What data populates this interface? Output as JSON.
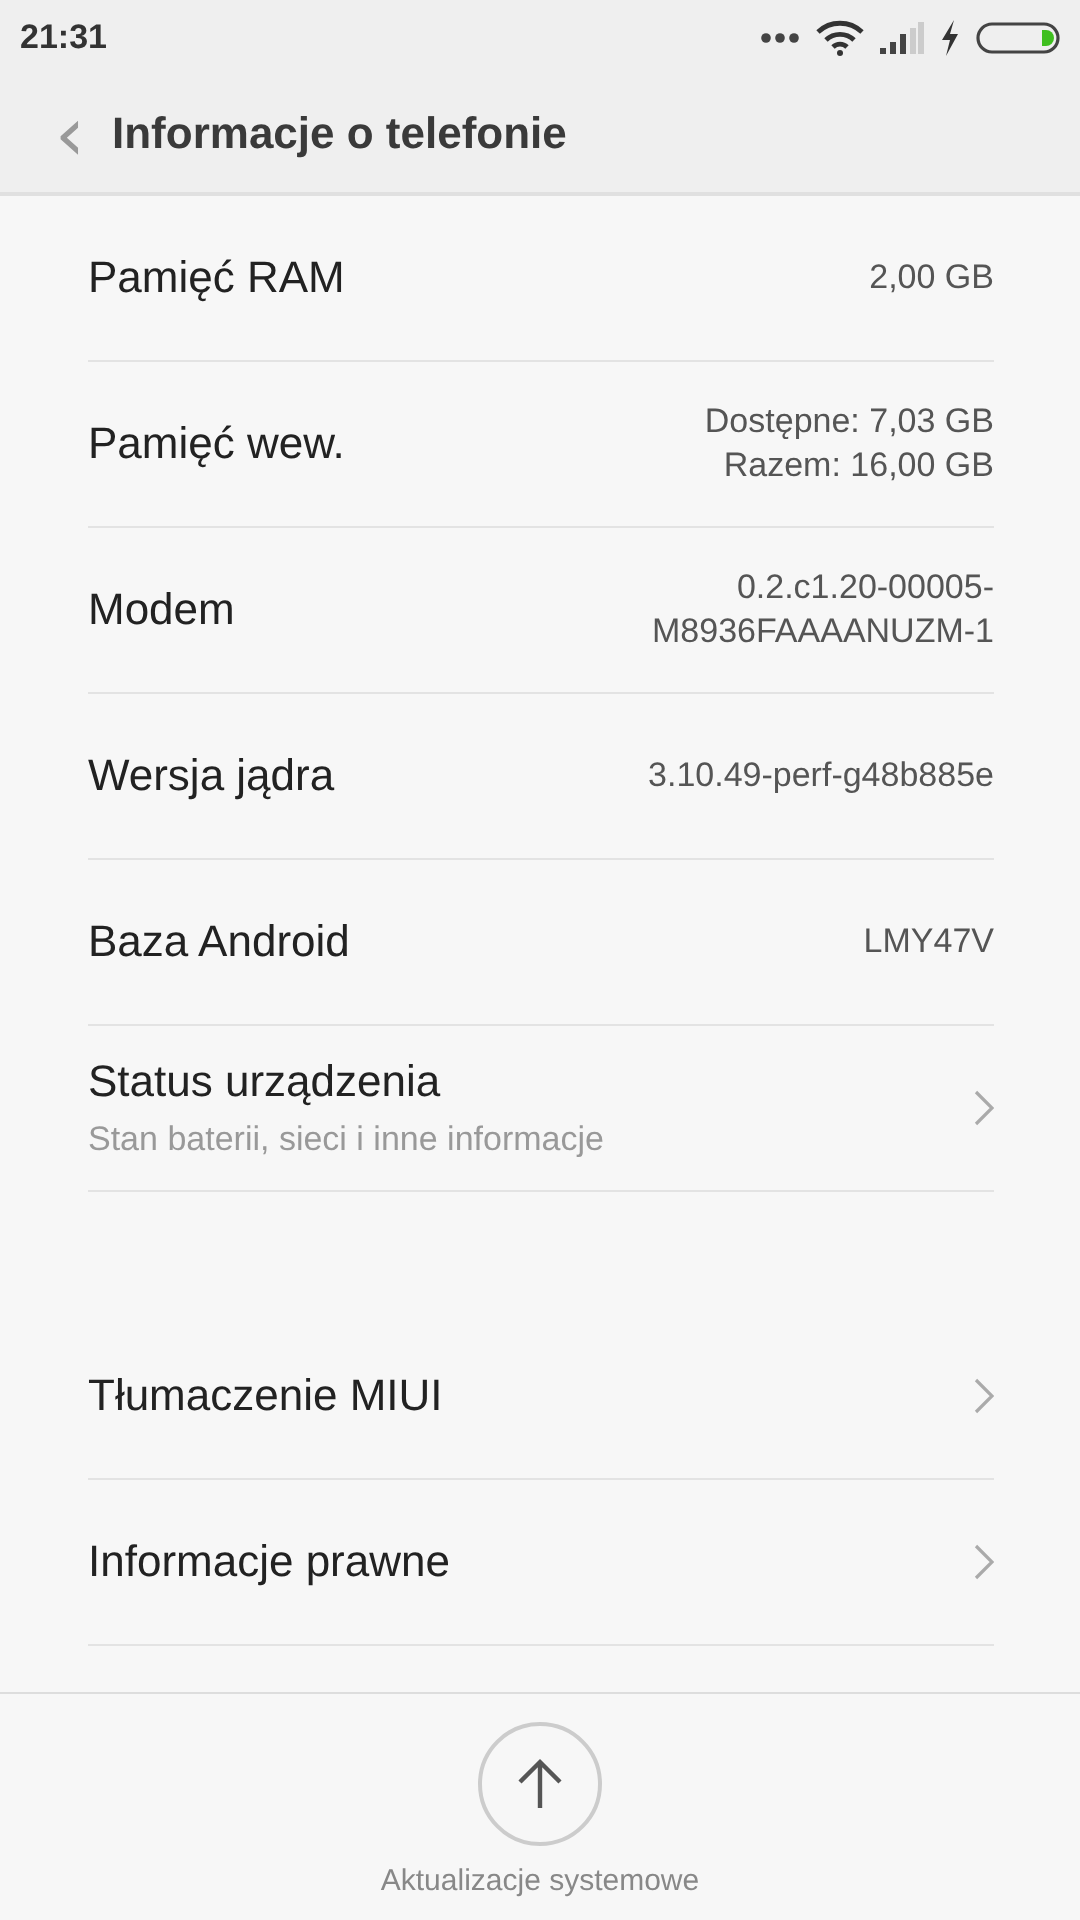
{
  "status_bar": {
    "time": "21:31"
  },
  "header": {
    "back": "‹",
    "title": "Informacje o telefonie"
  },
  "groups": [
    {
      "rows": [
        {
          "kind": "value",
          "label": "Pamięć RAM",
          "values": [
            "2,00 GB"
          ]
        },
        {
          "kind": "value",
          "label": "Pamięć wew.",
          "values": [
            "Dostępne: 7,03 GB",
            "Razem: 16,00 GB"
          ]
        },
        {
          "kind": "value",
          "label": "Modem",
          "values": [
            "0.2.c1.20-00005-",
            "M8936FAAAANUZM-1"
          ]
        },
        {
          "kind": "value",
          "label": "Wersja jądra",
          "values": [
            "3.10.49-perf-g48b885e"
          ]
        },
        {
          "kind": "value",
          "label": "Baza Android",
          "values": [
            "LMY47V"
          ]
        },
        {
          "kind": "link",
          "label": "Status urządzenia",
          "subtitle": "Stan baterii, sieci i inne informacje"
        }
      ]
    },
    {
      "rows": [
        {
          "kind": "link",
          "label": "Tłumaczenie MIUI"
        },
        {
          "kind": "link",
          "label": "Informacje prawne"
        }
      ]
    }
  ],
  "footer": {
    "label": "Aktualizacje systemowe"
  }
}
